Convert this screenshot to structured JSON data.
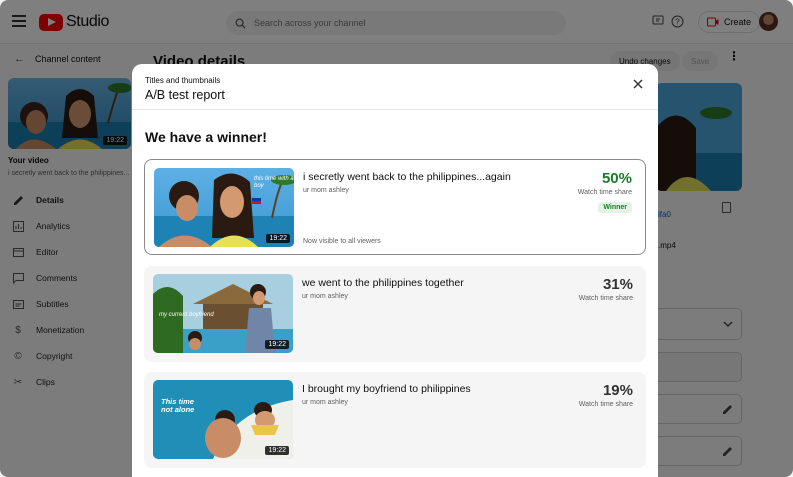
{
  "app": {
    "name": "Studio"
  },
  "search": {
    "placeholder": "Search across your channel"
  },
  "header": {
    "create_label": "Create"
  },
  "sidebar": {
    "back_label": "Channel content",
    "thumb_duration": "19:22",
    "your_video_label": "Your video",
    "video_subtitle": "i secretly went back to the philippines...",
    "items": [
      {
        "label": "Details",
        "icon": "pencil-icon"
      },
      {
        "label": "Analytics",
        "icon": "analytics-icon"
      },
      {
        "label": "Editor",
        "icon": "editor-icon"
      },
      {
        "label": "Comments",
        "icon": "comments-icon"
      },
      {
        "label": "Subtitles",
        "icon": "subtitles-icon"
      },
      {
        "label": "Monetization",
        "icon": "dollar-icon"
      },
      {
        "label": "Copyright",
        "icon": "copyright-icon"
      },
      {
        "label": "Clips",
        "icon": "scissors-icon"
      }
    ]
  },
  "background": {
    "page_title": "Video details",
    "undo_label": "Undo changes",
    "save_label": "Save",
    "link_fragment": "ifa0",
    "file_fragment": ".mp4"
  },
  "modal": {
    "subtitle": "Titles and thumbnails",
    "title": "A/B test report",
    "heading": "We have a winner!",
    "variants": [
      {
        "title": "i secretly went back to the philippines...again",
        "channel": "ur mom ashley",
        "share": "50%",
        "share_label": "Watch time share",
        "badge": "Winner",
        "note": "Now visible to all viewers",
        "duration": "19:22",
        "overlay_text": "this time with a boy"
      },
      {
        "title": "we went to the philippines together",
        "channel": "ur mom ashley",
        "share": "31%",
        "share_label": "Watch time share",
        "duration": "19:22",
        "overlay_text": "my current boyfriend"
      },
      {
        "title": "I brought my boyfriend to philippines",
        "channel": "ur mom ashley",
        "share": "19%",
        "share_label": "Watch time share",
        "duration": "19:22",
        "overlay_text": "This time not alone"
      }
    ]
  },
  "colors": {
    "brand": "#ff0000",
    "winner": "#1c7a2b",
    "link": "#065fd4"
  }
}
